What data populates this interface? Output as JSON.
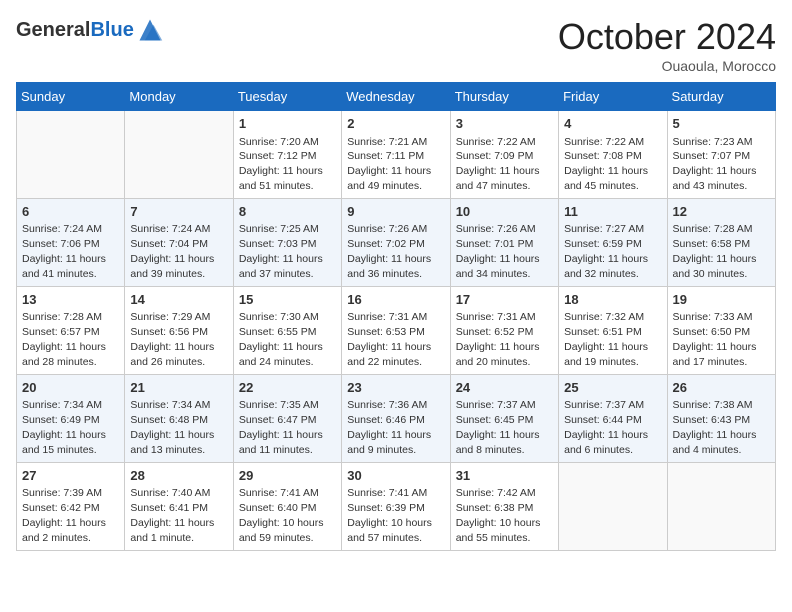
{
  "header": {
    "logo_line1": "General",
    "logo_line2": "Blue",
    "month_title": "October 2024",
    "location": "Ouaoula, Morocco"
  },
  "days_of_week": [
    "Sunday",
    "Monday",
    "Tuesday",
    "Wednesday",
    "Thursday",
    "Friday",
    "Saturday"
  ],
  "weeks": [
    [
      {
        "day": "",
        "info": ""
      },
      {
        "day": "",
        "info": ""
      },
      {
        "day": "1",
        "info": "Sunrise: 7:20 AM\nSunset: 7:12 PM\nDaylight: 11 hours and 51 minutes."
      },
      {
        "day": "2",
        "info": "Sunrise: 7:21 AM\nSunset: 7:11 PM\nDaylight: 11 hours and 49 minutes."
      },
      {
        "day": "3",
        "info": "Sunrise: 7:22 AM\nSunset: 7:09 PM\nDaylight: 11 hours and 47 minutes."
      },
      {
        "day": "4",
        "info": "Sunrise: 7:22 AM\nSunset: 7:08 PM\nDaylight: 11 hours and 45 minutes."
      },
      {
        "day": "5",
        "info": "Sunrise: 7:23 AM\nSunset: 7:07 PM\nDaylight: 11 hours and 43 minutes."
      }
    ],
    [
      {
        "day": "6",
        "info": "Sunrise: 7:24 AM\nSunset: 7:06 PM\nDaylight: 11 hours and 41 minutes."
      },
      {
        "day": "7",
        "info": "Sunrise: 7:24 AM\nSunset: 7:04 PM\nDaylight: 11 hours and 39 minutes."
      },
      {
        "day": "8",
        "info": "Sunrise: 7:25 AM\nSunset: 7:03 PM\nDaylight: 11 hours and 37 minutes."
      },
      {
        "day": "9",
        "info": "Sunrise: 7:26 AM\nSunset: 7:02 PM\nDaylight: 11 hours and 36 minutes."
      },
      {
        "day": "10",
        "info": "Sunrise: 7:26 AM\nSunset: 7:01 PM\nDaylight: 11 hours and 34 minutes."
      },
      {
        "day": "11",
        "info": "Sunrise: 7:27 AM\nSunset: 6:59 PM\nDaylight: 11 hours and 32 minutes."
      },
      {
        "day": "12",
        "info": "Sunrise: 7:28 AM\nSunset: 6:58 PM\nDaylight: 11 hours and 30 minutes."
      }
    ],
    [
      {
        "day": "13",
        "info": "Sunrise: 7:28 AM\nSunset: 6:57 PM\nDaylight: 11 hours and 28 minutes."
      },
      {
        "day": "14",
        "info": "Sunrise: 7:29 AM\nSunset: 6:56 PM\nDaylight: 11 hours and 26 minutes."
      },
      {
        "day": "15",
        "info": "Sunrise: 7:30 AM\nSunset: 6:55 PM\nDaylight: 11 hours and 24 minutes."
      },
      {
        "day": "16",
        "info": "Sunrise: 7:31 AM\nSunset: 6:53 PM\nDaylight: 11 hours and 22 minutes."
      },
      {
        "day": "17",
        "info": "Sunrise: 7:31 AM\nSunset: 6:52 PM\nDaylight: 11 hours and 20 minutes."
      },
      {
        "day": "18",
        "info": "Sunrise: 7:32 AM\nSunset: 6:51 PM\nDaylight: 11 hours and 19 minutes."
      },
      {
        "day": "19",
        "info": "Sunrise: 7:33 AM\nSunset: 6:50 PM\nDaylight: 11 hours and 17 minutes."
      }
    ],
    [
      {
        "day": "20",
        "info": "Sunrise: 7:34 AM\nSunset: 6:49 PM\nDaylight: 11 hours and 15 minutes."
      },
      {
        "day": "21",
        "info": "Sunrise: 7:34 AM\nSunset: 6:48 PM\nDaylight: 11 hours and 13 minutes."
      },
      {
        "day": "22",
        "info": "Sunrise: 7:35 AM\nSunset: 6:47 PM\nDaylight: 11 hours and 11 minutes."
      },
      {
        "day": "23",
        "info": "Sunrise: 7:36 AM\nSunset: 6:46 PM\nDaylight: 11 hours and 9 minutes."
      },
      {
        "day": "24",
        "info": "Sunrise: 7:37 AM\nSunset: 6:45 PM\nDaylight: 11 hours and 8 minutes."
      },
      {
        "day": "25",
        "info": "Sunrise: 7:37 AM\nSunset: 6:44 PM\nDaylight: 11 hours and 6 minutes."
      },
      {
        "day": "26",
        "info": "Sunrise: 7:38 AM\nSunset: 6:43 PM\nDaylight: 11 hours and 4 minutes."
      }
    ],
    [
      {
        "day": "27",
        "info": "Sunrise: 7:39 AM\nSunset: 6:42 PM\nDaylight: 11 hours and 2 minutes."
      },
      {
        "day": "28",
        "info": "Sunrise: 7:40 AM\nSunset: 6:41 PM\nDaylight: 11 hours and 1 minute."
      },
      {
        "day": "29",
        "info": "Sunrise: 7:41 AM\nSunset: 6:40 PM\nDaylight: 10 hours and 59 minutes."
      },
      {
        "day": "30",
        "info": "Sunrise: 7:41 AM\nSunset: 6:39 PM\nDaylight: 10 hours and 57 minutes."
      },
      {
        "day": "31",
        "info": "Sunrise: 7:42 AM\nSunset: 6:38 PM\nDaylight: 10 hours and 55 minutes."
      },
      {
        "day": "",
        "info": ""
      },
      {
        "day": "",
        "info": ""
      }
    ]
  ]
}
